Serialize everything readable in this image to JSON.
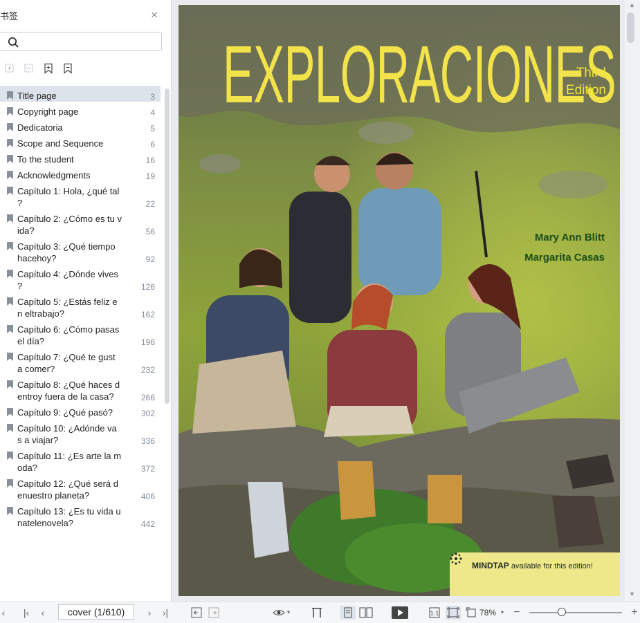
{
  "sidebar": {
    "title": "书签",
    "close_label": "×",
    "search": {
      "value": "",
      "placeholder": ""
    },
    "bookmarks": [
      {
        "label": "Title page",
        "page": "3"
      },
      {
        "label": "Copyright page",
        "page": "4"
      },
      {
        "label": "Dedicatoria",
        "page": "5"
      },
      {
        "label": "Scope and Sequence",
        "page": "6"
      },
      {
        "label": "To the student",
        "page": "16"
      },
      {
        "label": "Acknowledgments",
        "page": "19"
      },
      {
        "label": "Capítulo 1: Hola, ¿qué tal ?",
        "page": "22"
      },
      {
        "label": "Capítulo 2: ¿Cómo es tu vida?",
        "page": "56"
      },
      {
        "label": "Capítulo 3: ¿Qué tiempo hacehoy?",
        "page": "92"
      },
      {
        "label": "Capítulo 4: ¿Dónde vives ?",
        "page": "126"
      },
      {
        "label": "Capítulo 5: ¿Estás feliz e n eltrabajo?",
        "page": "162"
      },
      {
        "label": "Capítulo 6: ¿Cómo pasas el día?",
        "page": "196"
      },
      {
        "label": "Capítulo 7: ¿Qué te gust a comer?",
        "page": "232"
      },
      {
        "label": "Capítulo 8: ¿Qué haces d entroy fuera de la casa?",
        "page": "266"
      },
      {
        "label": "Capítulo 9: ¿Qué pasó?",
        "page": "302"
      },
      {
        "label": "Capítulo 10: ¿Adónde va s a viajar?",
        "page": "336"
      },
      {
        "label": "Capítulo 11: ¿Es arte la moda?",
        "page": "372"
      },
      {
        "label": "Capítulo 12: ¿Qué será d enuestro planeta?",
        "page": "406"
      },
      {
        "label": "Capítulo 13: ¿Es tu vida u natelenovela?",
        "page": "442"
      }
    ]
  },
  "cover": {
    "title": "EXPLORACIONES",
    "edition_line1": "Third",
    "edition_line2": "Edition",
    "author1": "Mary Ann Blitt",
    "author2": "Margarita Casas",
    "mindtap_brand": "MINDTAP",
    "mindtap_text": " available for this edition!"
  },
  "statusbar": {
    "page_indicator": "cover (1/610)",
    "zoom": "78%",
    "zoom_level": 0.35
  },
  "colors": {
    "accent_title": "#f3e34a",
    "author_green": "#1b4d1c",
    "selected_bookmark": "#dde3ea"
  }
}
